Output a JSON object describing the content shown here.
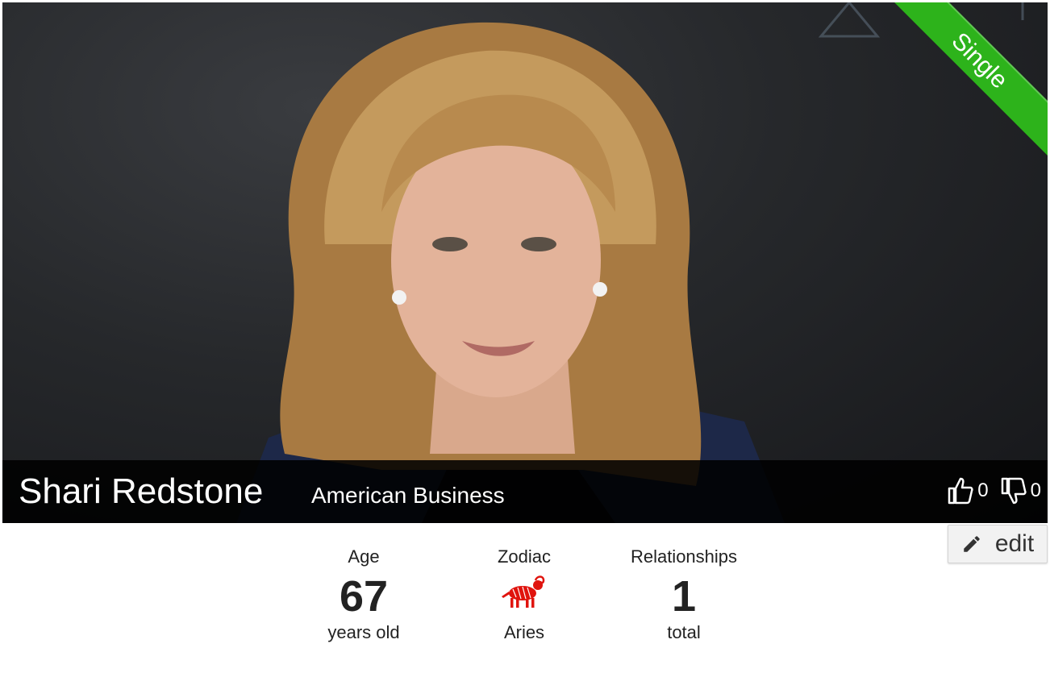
{
  "profile": {
    "name": "Shari Redstone",
    "occupation": "American Business",
    "relationship_status": "Single"
  },
  "votes": {
    "likes": "0",
    "dislikes": "0"
  },
  "actions": {
    "edit_label": "edit"
  },
  "stats": {
    "age": {
      "label": "Age",
      "value": "67",
      "sub": "years old"
    },
    "zodiac": {
      "label": "Zodiac",
      "value": "Aries",
      "icon": "aries-ram-icon"
    },
    "relationships": {
      "label": "Relationships",
      "value": "1",
      "sub": "total"
    }
  },
  "colors": {
    "status_ribbon": "#2db31b",
    "zodiac_icon": "#e0140e"
  }
}
